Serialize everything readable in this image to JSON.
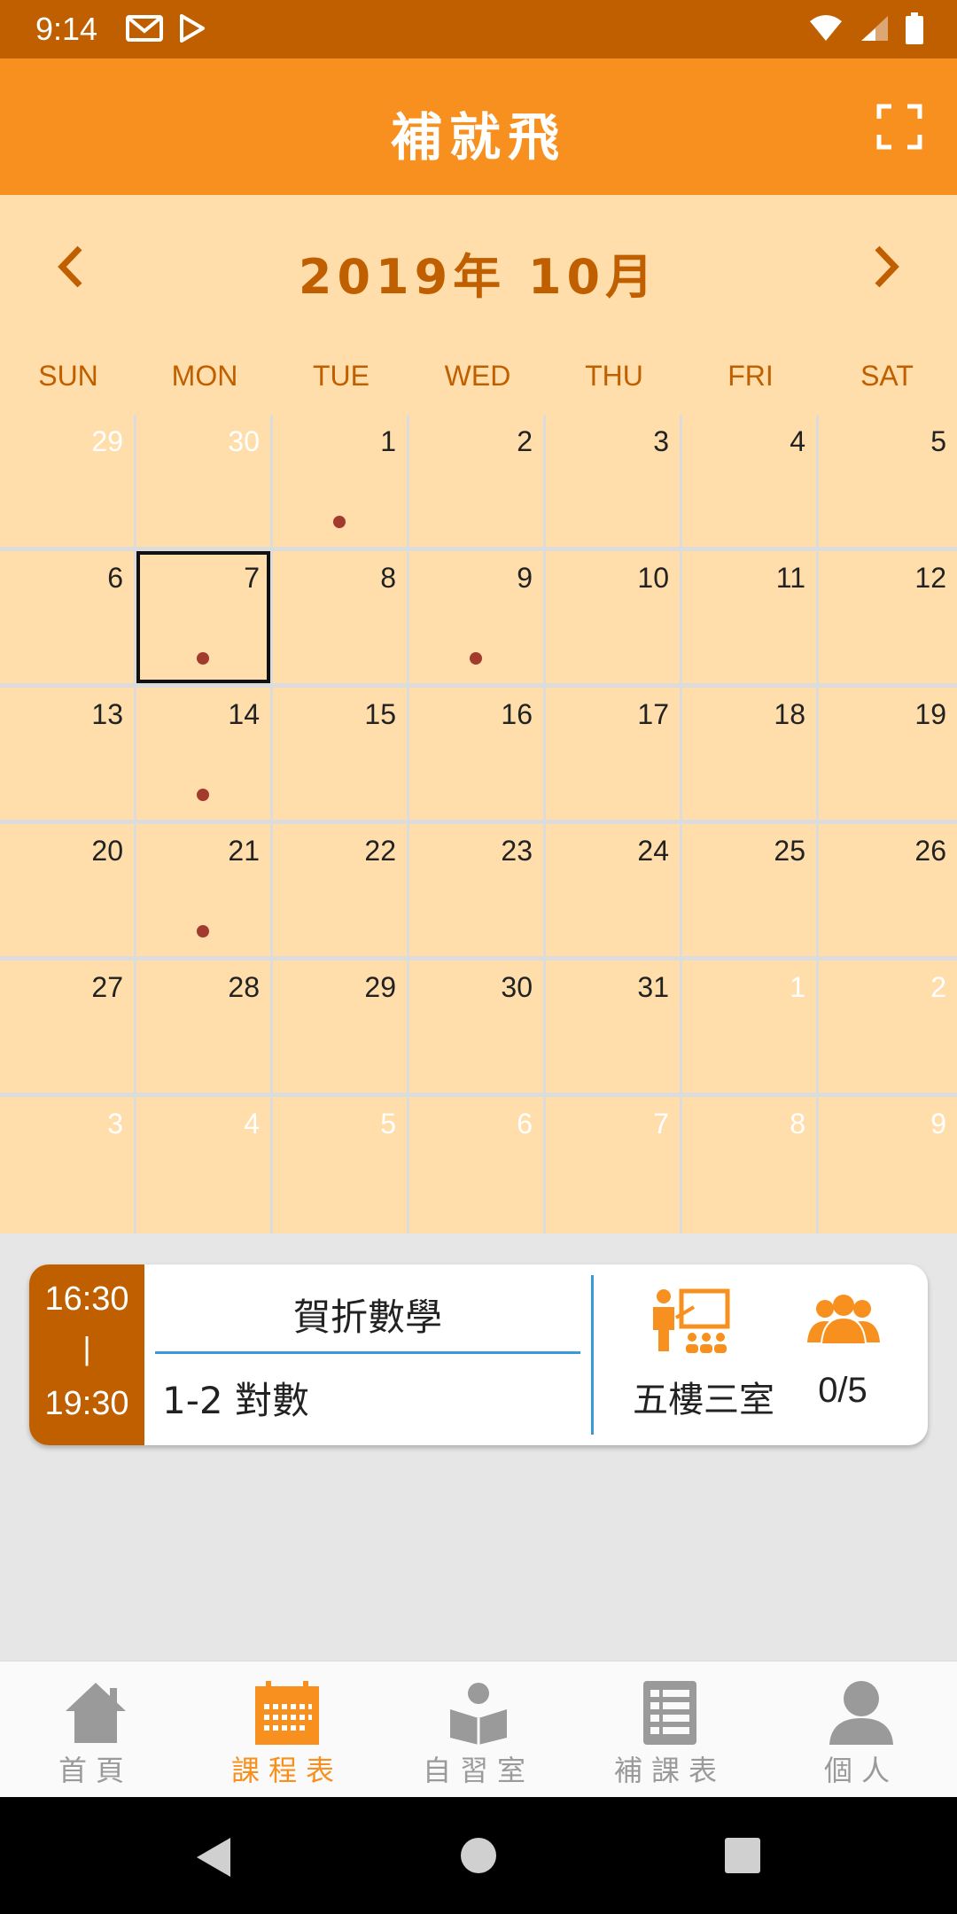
{
  "status_bar": {
    "time": "9:14"
  },
  "app_bar": {
    "title": "補就飛"
  },
  "calendar": {
    "month_title": "2019年 10月",
    "weekdays": [
      "SUN",
      "MON",
      "TUE",
      "WED",
      "THU",
      "FRI",
      "SAT"
    ],
    "days": [
      [
        "29",
        "30",
        "1",
        "2",
        "3",
        "4",
        "5"
      ],
      [
        "6",
        "7",
        "8",
        "9",
        "10",
        "11",
        "12"
      ],
      [
        "13",
        "14",
        "15",
        "16",
        "17",
        "18",
        "19"
      ],
      [
        "20",
        "21",
        "22",
        "23",
        "24",
        "25",
        "26"
      ],
      [
        "27",
        "28",
        "29",
        "30",
        "31",
        "1",
        "2"
      ],
      [
        "3",
        "4",
        "5",
        "6",
        "7",
        "8",
        "9"
      ]
    ],
    "selected_day": "7"
  },
  "course": {
    "start_time": "16:30",
    "separator": "|",
    "end_time": "19:30",
    "name": "賀折數學",
    "topic": "1-2 對數",
    "room": "五樓三室",
    "capacity": "0/5"
  },
  "bottom_nav": {
    "items": [
      {
        "label": "首頁",
        "icon": "home-icon"
      },
      {
        "label": "課程表",
        "icon": "calendar-icon"
      },
      {
        "label": "自習室",
        "icon": "study-reader-icon"
      },
      {
        "label": "補課表",
        "icon": "list-icon"
      },
      {
        "label": "個人",
        "icon": "person-icon"
      }
    ],
    "active_index": 1
  },
  "colors": {
    "primary_orange": "#f7901e",
    "dark_orange": "#bf5f00",
    "calendar_bg": "#ffdeab",
    "event_dot": "#a23b2e",
    "accent_blue": "#3a9ad9"
  }
}
